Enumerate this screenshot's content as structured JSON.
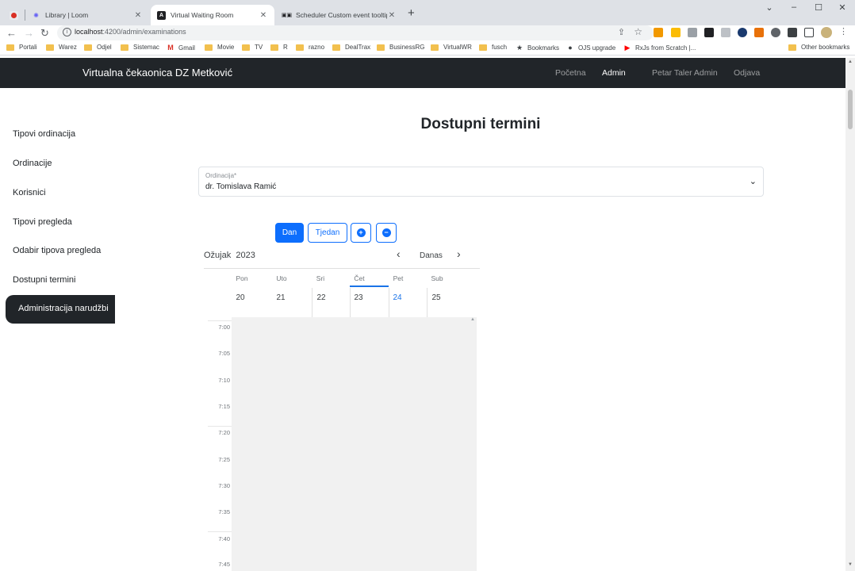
{
  "browser": {
    "tabs": [
      {
        "title": "",
        "icon": "loom-record-icon"
      },
      {
        "title": "Library | Loom",
        "icon": "loom-icon"
      },
      {
        "title": "Virtual Waiting Room",
        "icon": "angular-icon"
      },
      {
        "title": "Scheduler Custom event tooltip",
        "icon": "syncfusion-icon"
      }
    ],
    "url_host": "localhost",
    "url_path": ":4200/admin/examinations",
    "bookmarks": [
      "Portali",
      "Warez",
      "Odjel",
      "Sistemac",
      "Gmail",
      "Movie",
      "TV",
      "R",
      "razno",
      "DealTrax",
      "BusinessRG",
      "VirtualWR",
      "fusch",
      "Bookmarks",
      "OJS upgrade",
      "RxJs from Scratch |..."
    ],
    "other_bookmarks": "Other bookmarks"
  },
  "app": {
    "brand": "Virtualna čekaonica DZ Metković",
    "nav": [
      {
        "label": "Početna"
      },
      {
        "label": "Admin"
      },
      {
        "label": "Petar Taler Admin"
      },
      {
        "label": "Odjava"
      }
    ]
  },
  "sidebar": {
    "items": [
      {
        "label": "Tipovi ordinacija"
      },
      {
        "label": "Ordinacije"
      },
      {
        "label": "Korisnici"
      },
      {
        "label": "Tipovi pregleda"
      },
      {
        "label": "Odabir tipova pregleda"
      },
      {
        "label": "Dostupni termini"
      },
      {
        "label": "Administracija narudžbi"
      }
    ],
    "active_index": 6
  },
  "main": {
    "title": "Dostupni termini",
    "select": {
      "label": "Ordinacija*",
      "value": "dr. Tomislava Ramić"
    },
    "view_buttons": {
      "day": "Dan",
      "week": "Tjedan"
    },
    "zoom_in_symbol": "+",
    "zoom_out_symbol": "−"
  },
  "calendar": {
    "month": "Ožujak",
    "year": "2023",
    "today_label": "Danas",
    "days": [
      {
        "name": "Pon",
        "num": "20"
      },
      {
        "name": "Uto",
        "num": "21"
      },
      {
        "name": "Sri",
        "num": "22"
      },
      {
        "name": "Čet",
        "num": "23"
      },
      {
        "name": "Pet",
        "num": "24"
      },
      {
        "name": "Sub",
        "num": "25"
      }
    ],
    "highlighted_day": "Čet",
    "today_num": "24",
    "times": [
      "7:00",
      "7:05",
      "7:10",
      "7:15",
      "7:20",
      "7:25",
      "7:30",
      "7:35",
      "7:40",
      "7:45"
    ]
  },
  "colors": {
    "primary": "#0d6efd",
    "navbar": "#212529",
    "today": "#1a73e8"
  }
}
